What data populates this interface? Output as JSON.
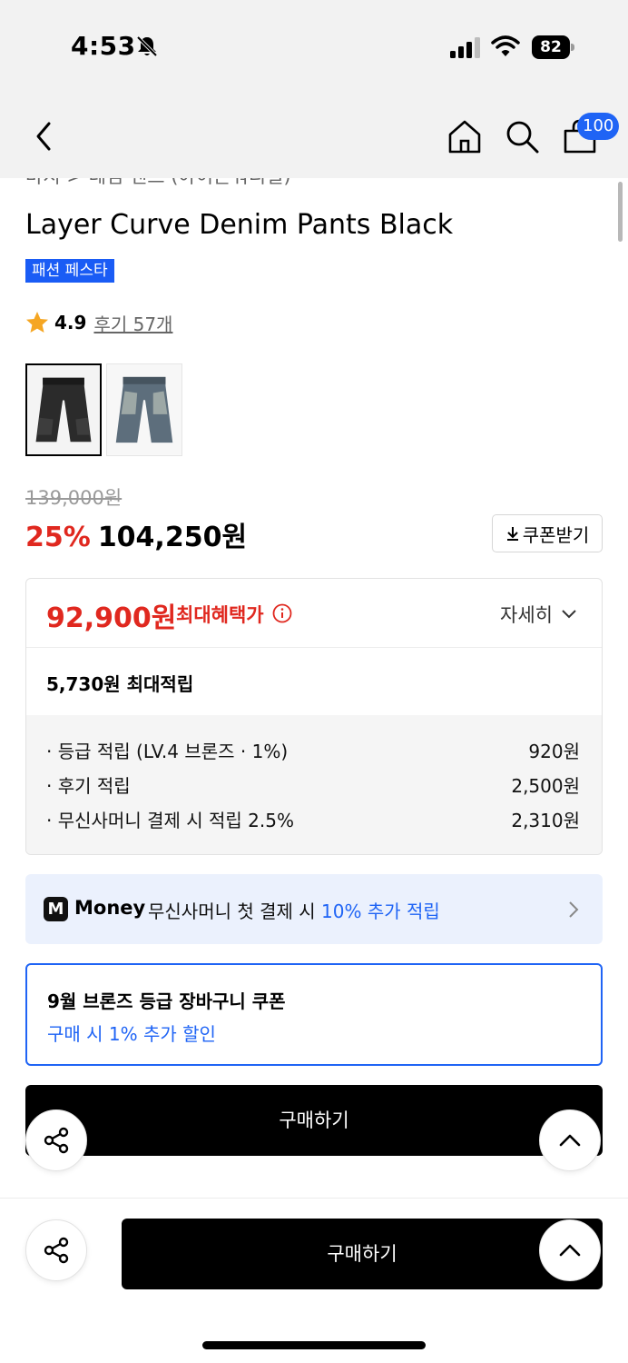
{
  "status_bar": {
    "time": "4:53",
    "battery": "82"
  },
  "nav": {
    "cart_count": "100"
  },
  "product": {
    "breadcrumb": "바지 > 데님 팬츠 (아이콘워디얼)",
    "title": "Layer Curve Denim Pants Black",
    "badge": "패션 페스타",
    "rating": "4.9",
    "reviews": "후기 57개",
    "thumbnails": [
      "black-denim",
      "blue-denim"
    ]
  },
  "pricing": {
    "original_price": "139,000원",
    "discount_pct": "25%",
    "sale_price": "104,250원",
    "coupon_button": "쿠폰받기"
  },
  "benefits": {
    "max_price": "92,900원",
    "max_label": "최대혜택가",
    "detail_label": "자세히",
    "accum_title": "5,730원 최대적립",
    "items": [
      {
        "label": "· 등급 적립 (LV.4 브론즈 · 1%)",
        "amount": "920원"
      },
      {
        "label": "· 후기 적립",
        "amount": "2,500원"
      },
      {
        "label": "· 무신사머니 결제 시 적립 2.5%",
        "amount": "2,310원"
      }
    ]
  },
  "money_banner": {
    "logo": "M",
    "brand": "Money",
    "text": "무신사머니 첫 결제 시 ",
    "highlight": "10% 추가 적립"
  },
  "coupon_card": {
    "title": "9월 브론즈 등급 장바구니 쿠폰",
    "subtitle": "구매 시 1% 추가 할인"
  },
  "actions": {
    "buy_label": "구매하기"
  },
  "colors": {
    "accent_blue": "#1f64f5",
    "sale_red": "#e0281f",
    "banner_bg": "#ebf1fd"
  }
}
